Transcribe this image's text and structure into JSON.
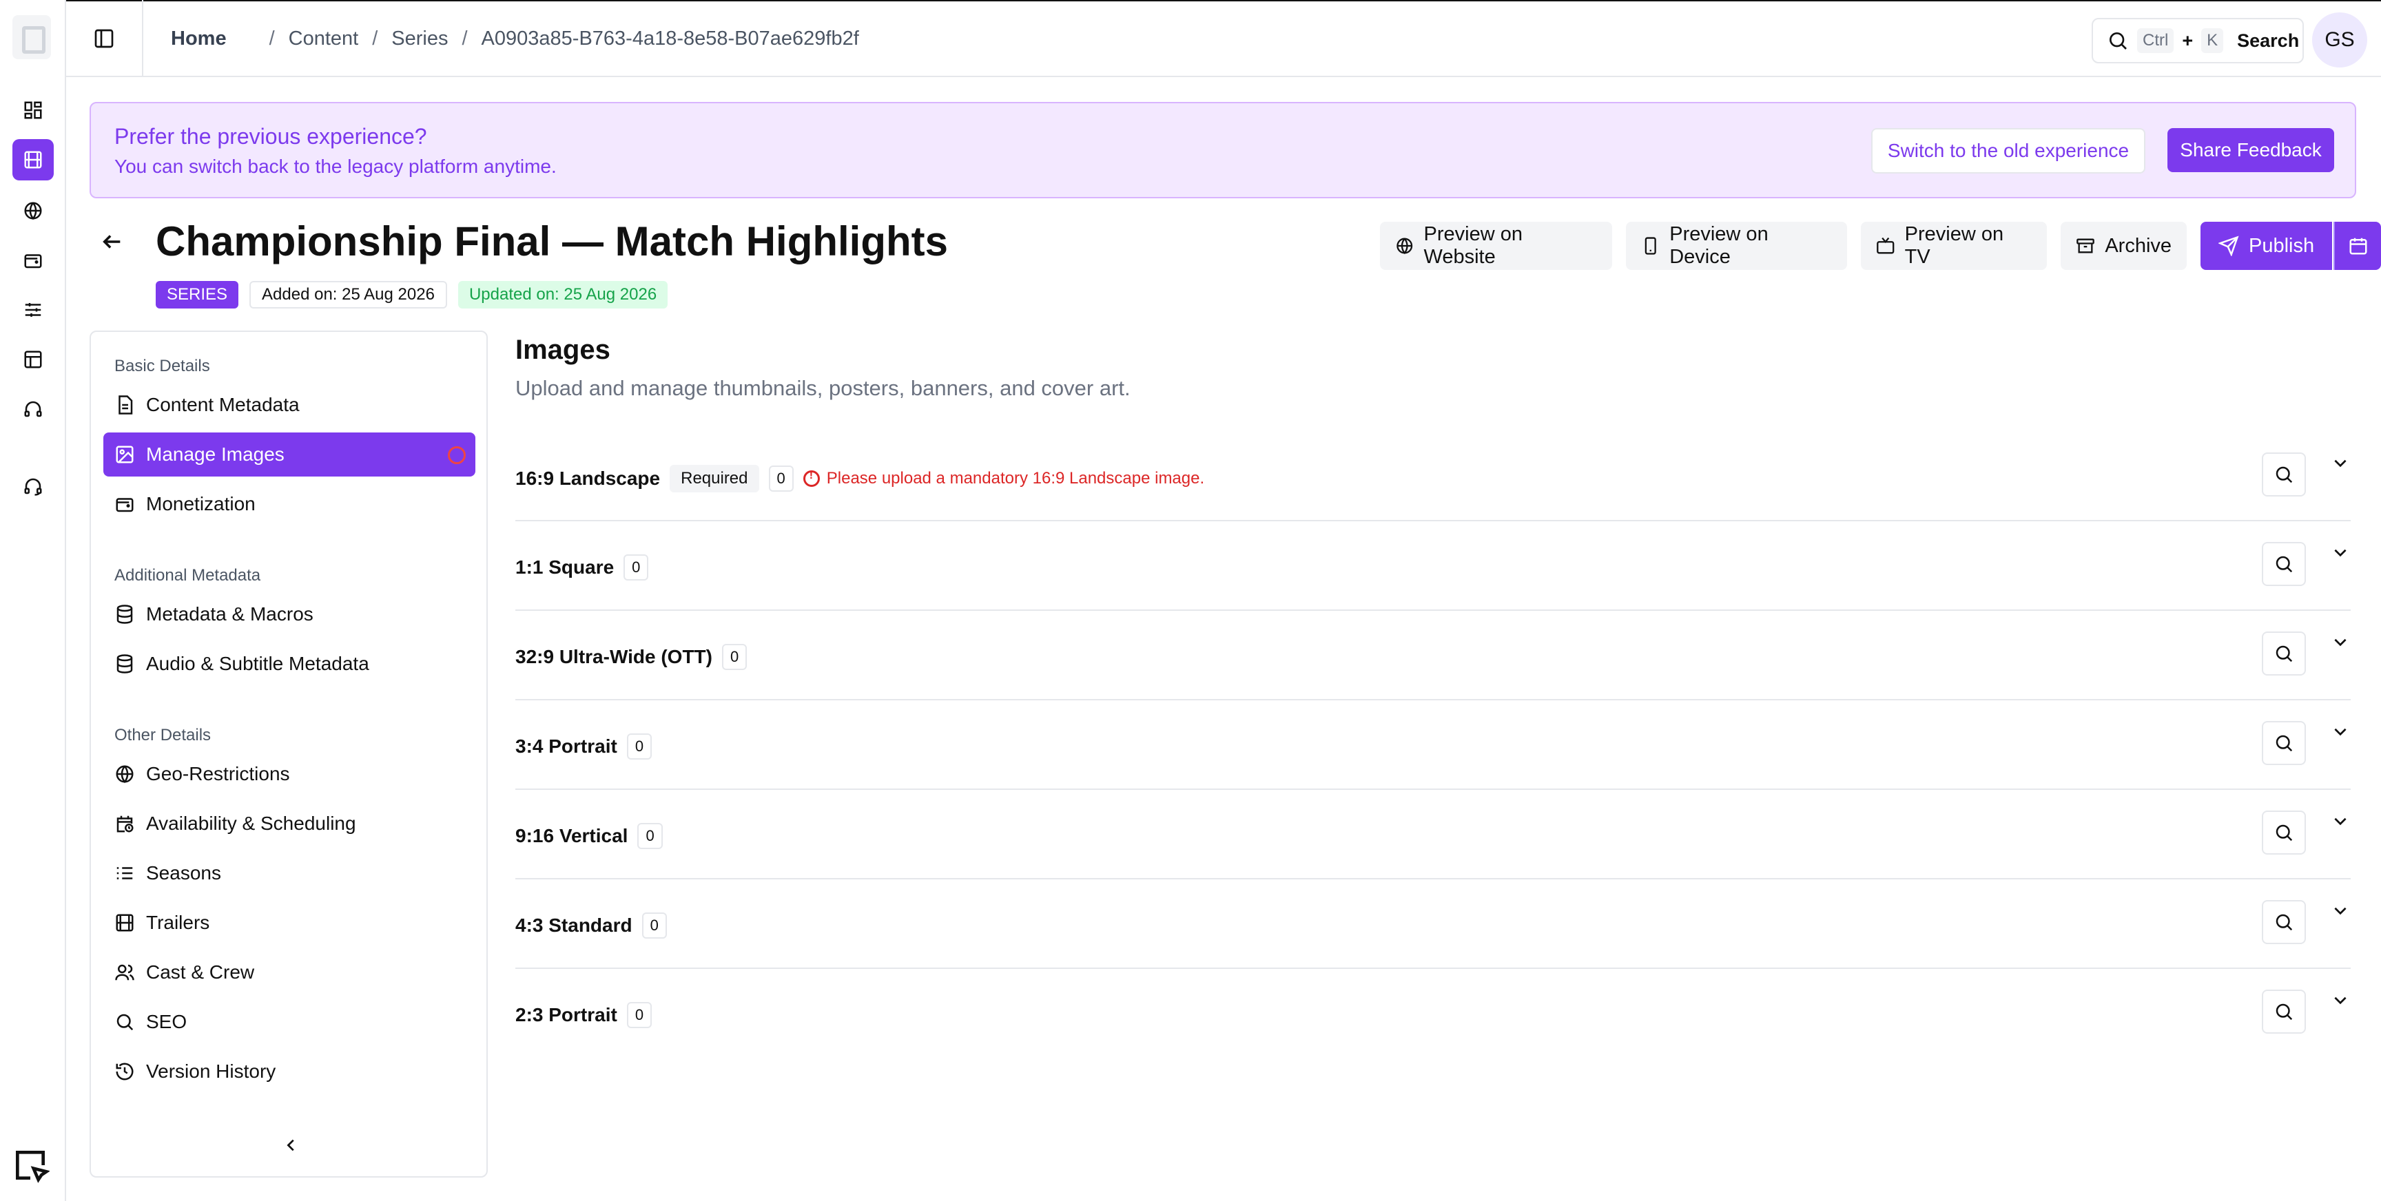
{
  "breadcrumb": {
    "home": "Home",
    "items": [
      "Content",
      "Series",
      "A0903a85-B763-4a18-8e58-B07ae629fb2f"
    ]
  },
  "search": {
    "ctrl": "Ctrl",
    "plus": "+",
    "key": "K",
    "label": "Search"
  },
  "user": {
    "initials": "GS"
  },
  "banner": {
    "title": "Prefer the previous experience?",
    "subtitle": "You can switch back to the legacy platform anytime.",
    "switch_label": "Switch to the old experience",
    "feedback_label": "Share Feedback"
  },
  "header": {
    "title": "Championship Final — Match Highlights",
    "type_badge": "SERIES",
    "added": "Added on: 25 Aug 2026",
    "updated": "Updated on: 25 Aug 2026"
  },
  "actions": {
    "preview_website": "Preview on Website",
    "preview_device": "Preview on Device",
    "preview_tv": "Preview on TV",
    "archive": "Archive",
    "publish": "Publish"
  },
  "nav": {
    "groups": [
      "Basic Details",
      "Additional Metadata",
      "Other Details"
    ],
    "items": [
      {
        "label": "Content Metadata",
        "icon": "document-icon"
      },
      {
        "label": "Manage Images",
        "icon": "image-icon"
      },
      {
        "label": "Monetization",
        "icon": "wallet-icon"
      },
      {
        "label": "Metadata & Macros",
        "icon": "database-icon"
      },
      {
        "label": "Audio & Subtitle Metadata",
        "icon": "database-icon"
      },
      {
        "label": "Geo-Restrictions",
        "icon": "globe-icon"
      },
      {
        "label": "Availability & Scheduling",
        "icon": "calendar-clock-icon"
      },
      {
        "label": "Seasons",
        "icon": "list-icon"
      },
      {
        "label": "Trailers",
        "icon": "film-icon"
      },
      {
        "label": "Cast & Crew",
        "icon": "users-icon"
      },
      {
        "label": "SEO",
        "icon": "search-icon"
      },
      {
        "label": "Version History",
        "icon": "history-icon"
      }
    ]
  },
  "main": {
    "title": "Images",
    "subtitle": "Upload and manage thumbnails, posters, banners, and cover art.",
    "rows": [
      {
        "label": "16:9 Landscape",
        "required": "Required",
        "count": "0",
        "error": "Please upload a mandatory 16:9 Landscape image."
      },
      {
        "label": "1:1 Square",
        "count": "0"
      },
      {
        "label": "32:9 Ultra-Wide (OTT)",
        "count": "0"
      },
      {
        "label": "3:4 Portrait",
        "count": "0"
      },
      {
        "label": "9:16 Vertical",
        "count": "0"
      },
      {
        "label": "4:3 Standard",
        "count": "0"
      },
      {
        "label": "2:3 Portrait",
        "count": "0"
      }
    ]
  },
  "colors": {
    "accent": "#7c3aed",
    "banner_bg": "#f3e8ff",
    "error": "#dc2626",
    "success": "#16a34a"
  }
}
